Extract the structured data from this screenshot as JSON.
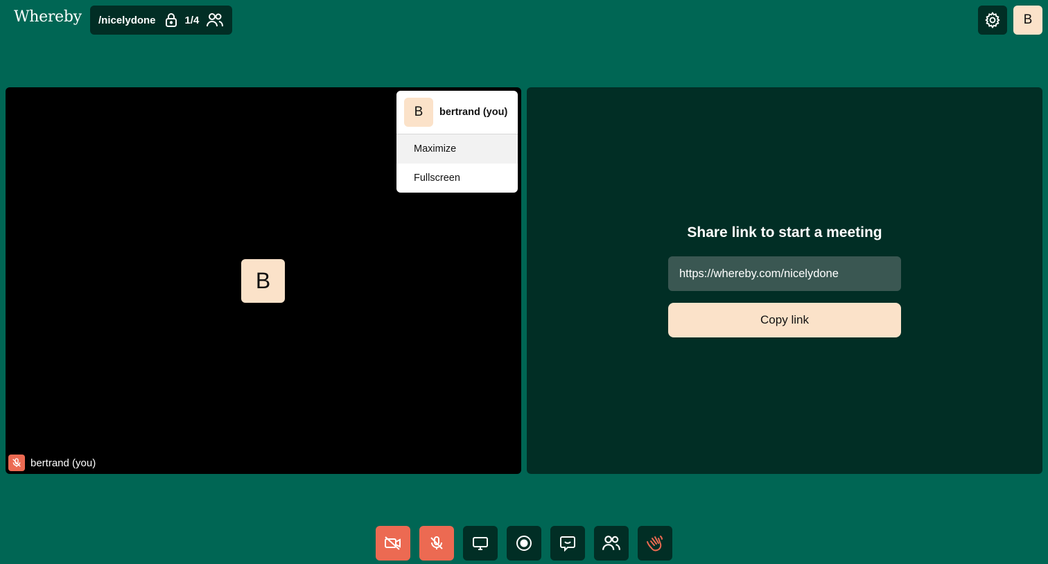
{
  "app": {
    "logo": "Whereby"
  },
  "room": {
    "name": "/nicelydone",
    "count": "1/4"
  },
  "user": {
    "initial": "B"
  },
  "tile": {
    "initial": "B",
    "name": "bertrand (you)"
  },
  "menu": {
    "initial": "B",
    "name": "bertrand (you)",
    "items": [
      "Maximize",
      "Fullscreen"
    ]
  },
  "share": {
    "title": "Share link to start a meeting",
    "url": "https://whereby.com/nicelydone",
    "copy_label": "Copy link"
  },
  "toolbar": {
    "items": [
      "camera-off-icon",
      "mic-off-icon",
      "screenshare-icon",
      "record-icon",
      "chat-icon",
      "people-icon",
      "wave-hand-icon"
    ]
  },
  "colors": {
    "background": "#006654",
    "panel": "#012e25",
    "accent_cream": "#fbe2c9",
    "danger": "#ec6a52"
  }
}
